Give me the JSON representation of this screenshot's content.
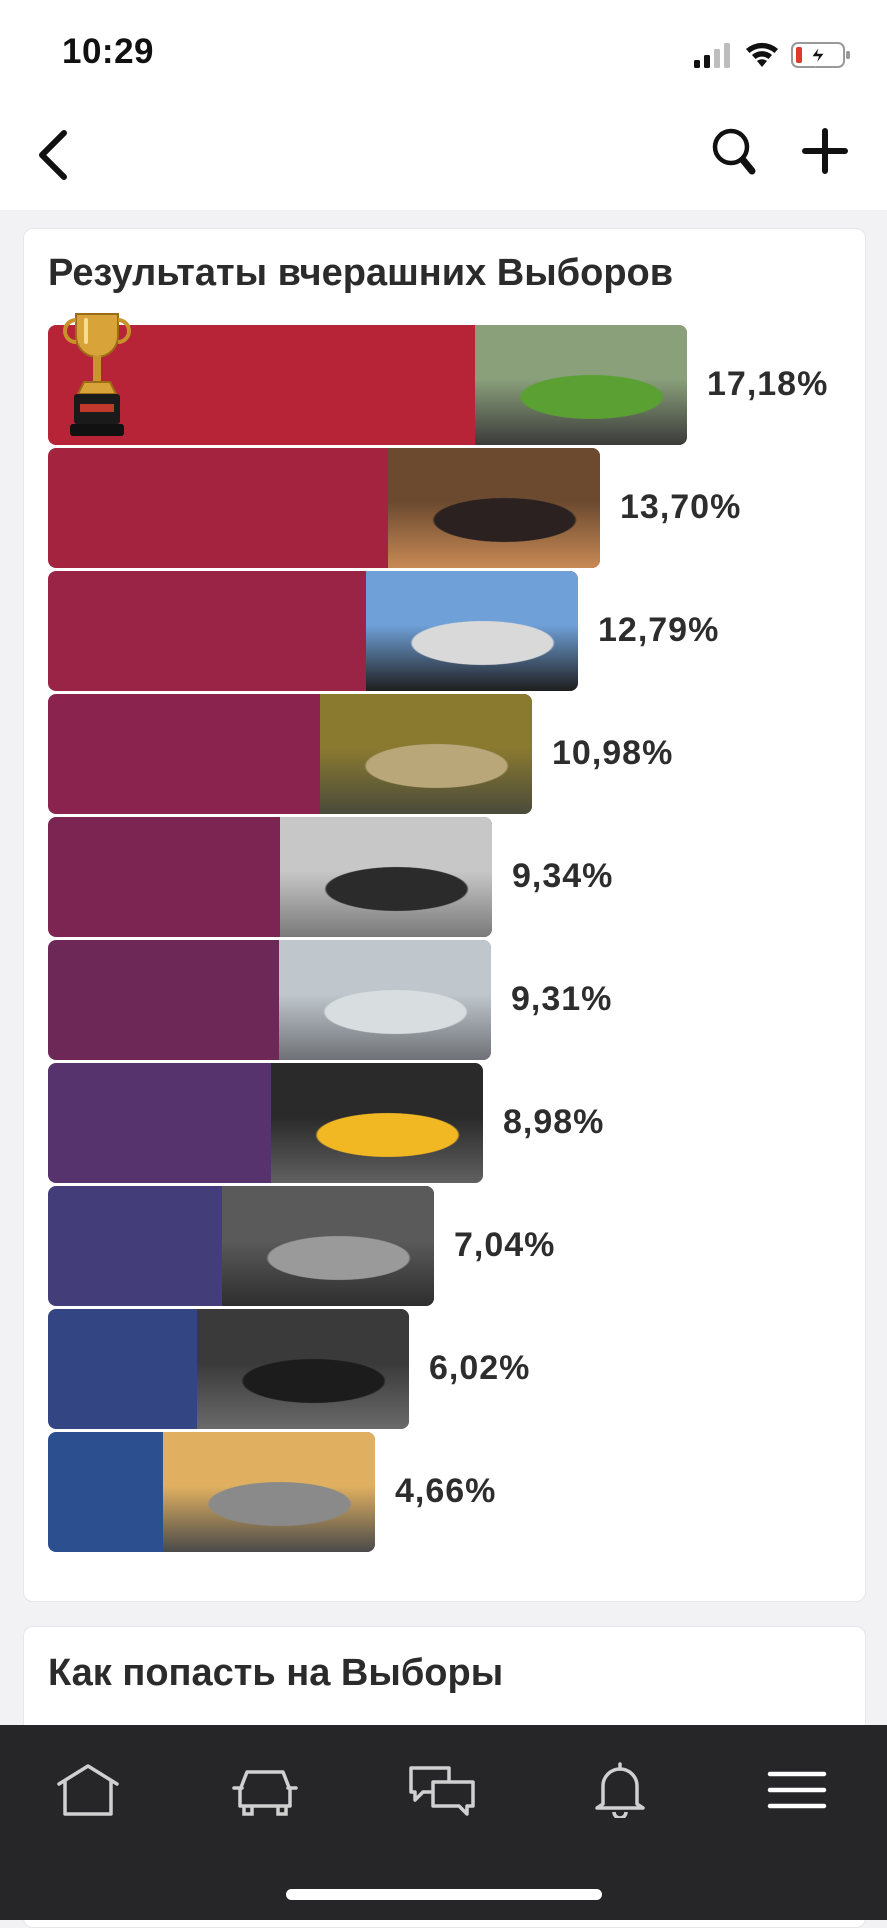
{
  "status_bar": {
    "time": "10:29"
  },
  "nav": {
    "back_icon": "chevron-left-icon",
    "search_icon": "search-icon",
    "add_icon": "plus-icon"
  },
  "results": {
    "title": "Результаты вчерашних Выборов",
    "items": [
      {
        "value": 17.18,
        "label": "17,18%",
        "color": "#b72337",
        "photo": [
          "#8aa07a",
          "#5aa032",
          "#3b3b3b"
        ]
      },
      {
        "value": 13.7,
        "label": "13,70%",
        "color": "#a4243f",
        "photo": [
          "#6b4a30",
          "#2a2120",
          "#c98a55"
        ]
      },
      {
        "value": 12.79,
        "label": "12,79%",
        "color": "#9a2446",
        "photo": [
          "#6fa0d8",
          "#d9d9d9",
          "#1e1e1e"
        ]
      },
      {
        "value": 10.98,
        "label": "10,98%",
        "color": "#8a244e",
        "photo": [
          "#8a7a30",
          "#b9a77a",
          "#4a4a3a"
        ]
      },
      {
        "value": 9.34,
        "label": "9,34%",
        "color": "#7d2552",
        "photo": [
          "#c7c7c7",
          "#2b2b2b",
          "#7a7a7a"
        ]
      },
      {
        "value": 9.31,
        "label": "9,31%",
        "color": "#6d2858",
        "photo": [
          "#bfc6cc",
          "#d8dde0",
          "#6e7277"
        ]
      },
      {
        "value": 8.98,
        "label": "8,98%",
        "color": "#56336c",
        "photo": [
          "#2a2a2a",
          "#f1b823",
          "#606060"
        ]
      },
      {
        "value": 7.04,
        "label": "7,04%",
        "color": "#433d7a",
        "photo": [
          "#5a5a5a",
          "#9a9a9a",
          "#2e2e2e"
        ]
      },
      {
        "value": 6.02,
        "label": "6,02%",
        "color": "#344584",
        "photo": [
          "#3a3a3a",
          "#1c1c1c",
          "#6a6a6a"
        ]
      },
      {
        "value": 4.66,
        "label": "4,66%",
        "color": "#2c4f8f",
        "photo": [
          "#e0b060",
          "#8a8a8a",
          "#4a4a4a"
        ]
      }
    ],
    "winner_badge": "trophy-icon"
  },
  "how_to": {
    "title": "Как попасть на Выборы"
  },
  "tabs": [
    {
      "name": "tab-home",
      "icon": "home-icon"
    },
    {
      "name": "tab-garage",
      "icon": "car-icon"
    },
    {
      "name": "tab-messages",
      "icon": "chat-icon"
    },
    {
      "name": "tab-notifications",
      "icon": "bell-icon"
    },
    {
      "name": "tab-menu",
      "icon": "menu-icon"
    }
  ]
}
